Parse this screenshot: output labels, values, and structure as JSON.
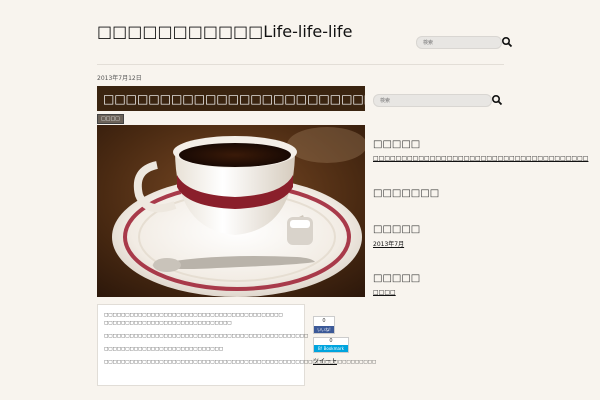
{
  "header": {
    "site_title": "□□□□□□□□□□□Life-life-life",
    "search_placeholder": "検索"
  },
  "post": {
    "date": "2013年7月12日",
    "title": "□□□□□□□□□□□□□□□□□□□□□□□□□□□□□□□□",
    "category": "□□□□",
    "paragraphs": [
      "□□□□□□□□□□□□□□□□□□□□□□□□□□□□□□□□□□□□□□□□□□",
      "□□□□□□□□□□□□□□□□□□□□□□□□□□□□□□",
      "□□□□□□□□□□□□□□□□□□□□□□□□□□□□□□□□□□□□□□□□□□□□□□□□",
      "□□□□□□□□□□□□□□□□□□□□□□□□□□□□",
      "□□□□□□□□□□□□□□□□□□□□□□□□□□□□□□□□□□□□□□□□□□□□□□□□□□□□□□□□□□□□□□□□"
    ]
  },
  "share": {
    "fb_count": "0",
    "fb_label": "いいね!",
    "hb_count": "0",
    "hb_label": "B! Bookmark",
    "tweet_label": "ツイート"
  },
  "sidebar": {
    "search_placeholder": "検索",
    "recent_title": "□□□□□",
    "recent_link": "□□□□□□□□□□□□□□□□□□□□□□□□□□□□□□□□□□□□□□",
    "comments_title": "□□□□□□□",
    "archive_title": "□□□□□",
    "archive_link": "2013年7月",
    "category_title": "□□□□□",
    "category_link": "□□□□"
  },
  "colors": {
    "background": "#f8f4ee",
    "title_bar": "#3a2410",
    "facebook": "#3b5998",
    "hatena": "#00a4de"
  },
  "icons": {
    "search": "magnifier-icon"
  }
}
